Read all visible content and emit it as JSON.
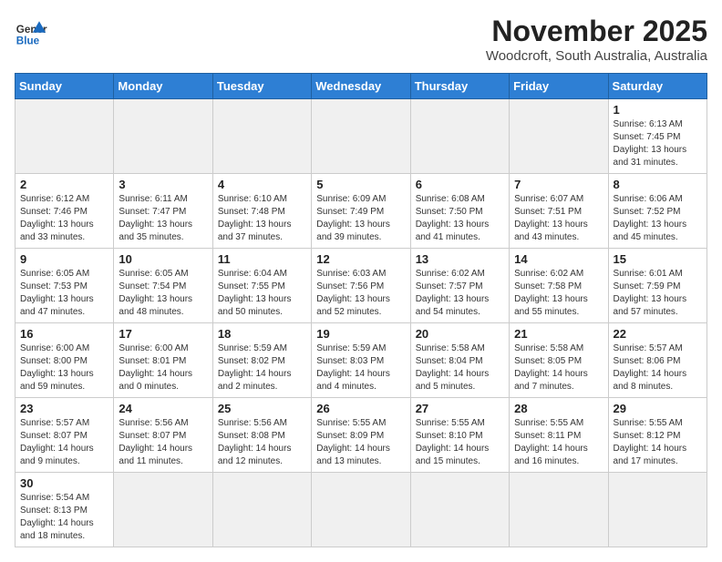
{
  "header": {
    "logo_general": "General",
    "logo_blue": "Blue",
    "month": "November 2025",
    "location": "Woodcroft, South Australia, Australia"
  },
  "days_of_week": [
    "Sunday",
    "Monday",
    "Tuesday",
    "Wednesday",
    "Thursday",
    "Friday",
    "Saturday"
  ],
  "weeks": [
    [
      {
        "day": "",
        "info": ""
      },
      {
        "day": "",
        "info": ""
      },
      {
        "day": "",
        "info": ""
      },
      {
        "day": "",
        "info": ""
      },
      {
        "day": "",
        "info": ""
      },
      {
        "day": "",
        "info": ""
      },
      {
        "day": "1",
        "info": "Sunrise: 6:13 AM\nSunset: 7:45 PM\nDaylight: 13 hours\nand 31 minutes."
      }
    ],
    [
      {
        "day": "2",
        "info": "Sunrise: 6:12 AM\nSunset: 7:46 PM\nDaylight: 13 hours\nand 33 minutes."
      },
      {
        "day": "3",
        "info": "Sunrise: 6:11 AM\nSunset: 7:47 PM\nDaylight: 13 hours\nand 35 minutes."
      },
      {
        "day": "4",
        "info": "Sunrise: 6:10 AM\nSunset: 7:48 PM\nDaylight: 13 hours\nand 37 minutes."
      },
      {
        "day": "5",
        "info": "Sunrise: 6:09 AM\nSunset: 7:49 PM\nDaylight: 13 hours\nand 39 minutes."
      },
      {
        "day": "6",
        "info": "Sunrise: 6:08 AM\nSunset: 7:50 PM\nDaylight: 13 hours\nand 41 minutes."
      },
      {
        "day": "7",
        "info": "Sunrise: 6:07 AM\nSunset: 7:51 PM\nDaylight: 13 hours\nand 43 minutes."
      },
      {
        "day": "8",
        "info": "Sunrise: 6:06 AM\nSunset: 7:52 PM\nDaylight: 13 hours\nand 45 minutes."
      }
    ],
    [
      {
        "day": "9",
        "info": "Sunrise: 6:05 AM\nSunset: 7:53 PM\nDaylight: 13 hours\nand 47 minutes."
      },
      {
        "day": "10",
        "info": "Sunrise: 6:05 AM\nSunset: 7:54 PM\nDaylight: 13 hours\nand 48 minutes."
      },
      {
        "day": "11",
        "info": "Sunrise: 6:04 AM\nSunset: 7:55 PM\nDaylight: 13 hours\nand 50 minutes."
      },
      {
        "day": "12",
        "info": "Sunrise: 6:03 AM\nSunset: 7:56 PM\nDaylight: 13 hours\nand 52 minutes."
      },
      {
        "day": "13",
        "info": "Sunrise: 6:02 AM\nSunset: 7:57 PM\nDaylight: 13 hours\nand 54 minutes."
      },
      {
        "day": "14",
        "info": "Sunrise: 6:02 AM\nSunset: 7:58 PM\nDaylight: 13 hours\nand 55 minutes."
      },
      {
        "day": "15",
        "info": "Sunrise: 6:01 AM\nSunset: 7:59 PM\nDaylight: 13 hours\nand 57 minutes."
      }
    ],
    [
      {
        "day": "16",
        "info": "Sunrise: 6:00 AM\nSunset: 8:00 PM\nDaylight: 13 hours\nand 59 minutes."
      },
      {
        "day": "17",
        "info": "Sunrise: 6:00 AM\nSunset: 8:01 PM\nDaylight: 14 hours\nand 0 minutes."
      },
      {
        "day": "18",
        "info": "Sunrise: 5:59 AM\nSunset: 8:02 PM\nDaylight: 14 hours\nand 2 minutes."
      },
      {
        "day": "19",
        "info": "Sunrise: 5:59 AM\nSunset: 8:03 PM\nDaylight: 14 hours\nand 4 minutes."
      },
      {
        "day": "20",
        "info": "Sunrise: 5:58 AM\nSunset: 8:04 PM\nDaylight: 14 hours\nand 5 minutes."
      },
      {
        "day": "21",
        "info": "Sunrise: 5:58 AM\nSunset: 8:05 PM\nDaylight: 14 hours\nand 7 minutes."
      },
      {
        "day": "22",
        "info": "Sunrise: 5:57 AM\nSunset: 8:06 PM\nDaylight: 14 hours\nand 8 minutes."
      }
    ],
    [
      {
        "day": "23",
        "info": "Sunrise: 5:57 AM\nSunset: 8:07 PM\nDaylight: 14 hours\nand 9 minutes."
      },
      {
        "day": "24",
        "info": "Sunrise: 5:56 AM\nSunset: 8:07 PM\nDaylight: 14 hours\nand 11 minutes."
      },
      {
        "day": "25",
        "info": "Sunrise: 5:56 AM\nSunset: 8:08 PM\nDaylight: 14 hours\nand 12 minutes."
      },
      {
        "day": "26",
        "info": "Sunrise: 5:55 AM\nSunset: 8:09 PM\nDaylight: 14 hours\nand 13 minutes."
      },
      {
        "day": "27",
        "info": "Sunrise: 5:55 AM\nSunset: 8:10 PM\nDaylight: 14 hours\nand 15 minutes."
      },
      {
        "day": "28",
        "info": "Sunrise: 5:55 AM\nSunset: 8:11 PM\nDaylight: 14 hours\nand 16 minutes."
      },
      {
        "day": "29",
        "info": "Sunrise: 5:55 AM\nSunset: 8:12 PM\nDaylight: 14 hours\nand 17 minutes."
      }
    ],
    [
      {
        "day": "30",
        "info": "Sunrise: 5:54 AM\nSunset: 8:13 PM\nDaylight: 14 hours\nand 18 minutes."
      },
      {
        "day": "",
        "info": ""
      },
      {
        "day": "",
        "info": ""
      },
      {
        "day": "",
        "info": ""
      },
      {
        "day": "",
        "info": ""
      },
      {
        "day": "",
        "info": ""
      },
      {
        "day": "",
        "info": ""
      }
    ]
  ]
}
